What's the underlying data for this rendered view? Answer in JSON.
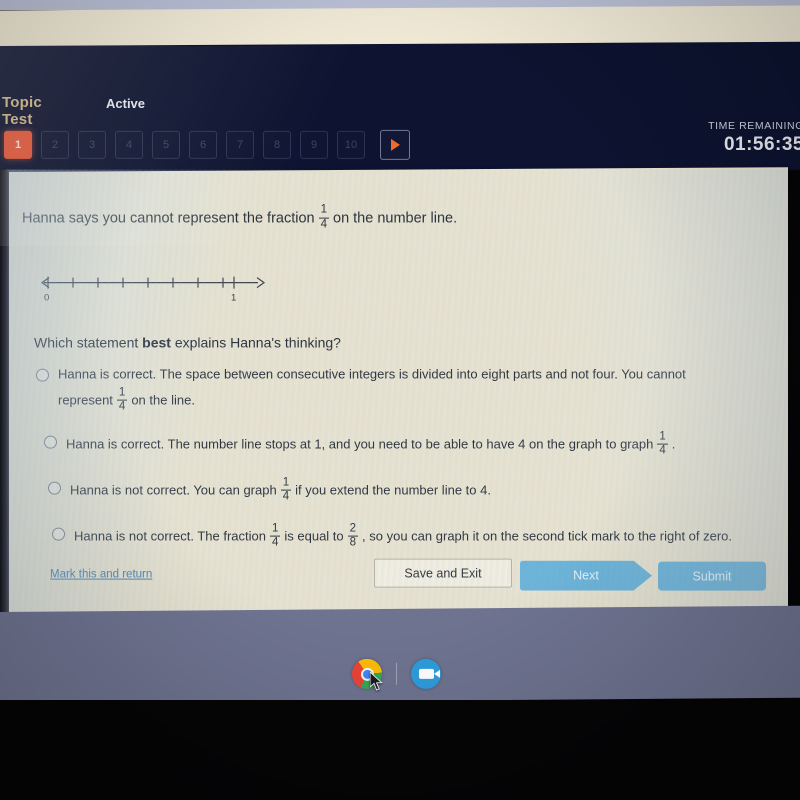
{
  "header": {
    "tab_topic": "Topic Test",
    "tab_active": "Active",
    "question_numbers": [
      "1",
      "2",
      "3",
      "4",
      "5",
      "6",
      "7",
      "8",
      "9",
      "10"
    ],
    "current_question": "1",
    "next_arrow_icon": "play-triangle-icon",
    "timer_label": "TIME REMAINING",
    "timer_value": "01:56:35",
    "accent_color": "#e8593a",
    "topic_color": "#d6b98a"
  },
  "question": {
    "stem_before": "Hanna says you cannot represent the fraction",
    "stem_fraction": {
      "numerator": "1",
      "denominator": "4"
    },
    "stem_after": "on the number line.",
    "ask_before": "Which statement ",
    "ask_bold": "best",
    "ask_after": " explains Hanna's thinking?"
  },
  "number_line": {
    "label_left": "0",
    "label_right": "1",
    "tick_count": 9,
    "intervals": 8,
    "left_arrow": true,
    "right_arrow": true
  },
  "choices": [
    {
      "id": "choice-a",
      "selected": false,
      "line1_before": "Hanna is correct. The space between consecutive integers is divided into eight parts and not four. You cannot",
      "line2_before": "represent",
      "fraction": {
        "numerator": "1",
        "denominator": "4"
      },
      "line2_after": "on the line.",
      "two_line": true
    },
    {
      "id": "choice-b",
      "selected": false,
      "line1_before": "Hanna is correct. The number line stops at 1, and you need to be able to have 4 on the graph to graph",
      "fraction": {
        "numerator": "1",
        "denominator": "4"
      },
      "line1_after": ".",
      "two_line": false
    },
    {
      "id": "choice-c",
      "selected": false,
      "line1_before": "Hanna is not correct. You can graph",
      "fraction": {
        "numerator": "1",
        "denominator": "4"
      },
      "line1_after": "if you extend the number line to 4.",
      "two_line": false
    },
    {
      "id": "choice-d",
      "selected": false,
      "line1_before": "Hanna is not correct. The fraction",
      "fraction": {
        "numerator": "1",
        "denominator": "4"
      },
      "mid_text": "is equal to",
      "fraction2": {
        "numerator": "2",
        "denominator": "8"
      },
      "line1_after": ", so you can graph it on the second tick mark to the right of zero.",
      "two_line": false
    }
  ],
  "actions": {
    "mark_link": "Mark this and return",
    "save_and_exit": "Save and Exit",
    "next": "Next",
    "submit": "Submit",
    "button_color": "#6ab3d8",
    "link_color": "#4a7fae"
  },
  "shelf": {
    "icons": [
      {
        "name": "chrome-icon",
        "label": "Chrome"
      },
      {
        "name": "zoom-icon",
        "label": "Zoom"
      }
    ],
    "background_color": "#6e7390"
  }
}
